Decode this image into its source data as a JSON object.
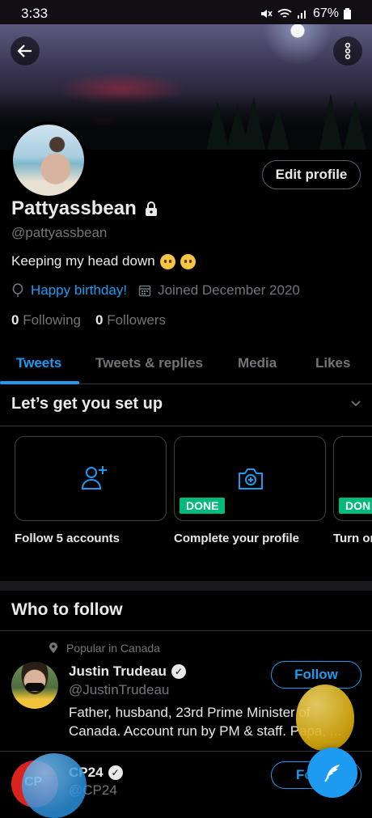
{
  "status_bar": {
    "time": "3:33",
    "battery": "67%",
    "icons": [
      "mute-icon",
      "wifi-icon",
      "signal-icon",
      "battery-icon"
    ]
  },
  "profile": {
    "display_name": "Pattyassbean",
    "handle": "@pattyassbean",
    "bio": "Keeping my head down",
    "birthday": "Happy birthday!",
    "joined": "Joined December 2020",
    "following_count": "0",
    "following_label": "Following",
    "followers_count": "0",
    "followers_label": "Followers",
    "edit_label": "Edit profile"
  },
  "tabs": [
    {
      "label": "Tweets",
      "active": true
    },
    {
      "label": "Tweets & replies",
      "active": false
    },
    {
      "label": "Media",
      "active": false
    },
    {
      "label": "Likes",
      "active": false
    }
  ],
  "setup": {
    "title": "Let’s get you set up",
    "cards": [
      {
        "label": "Follow 5 accounts",
        "icon": "add-user-icon",
        "badge": ""
      },
      {
        "label": "Complete your profile",
        "icon": "camera-add-icon",
        "badge": "DONE"
      },
      {
        "label": "Turn or",
        "icon": "",
        "badge": "DON"
      }
    ]
  },
  "who_to_follow": {
    "title": "Who to follow",
    "context": "Popular in Canada",
    "users": [
      {
        "name": "Justin Trudeau",
        "handle": "@JustinTrudeau",
        "bio": "Father, husband, 23rd Prime Minister of Canada. Account run by PM & staff. Papa, ...",
        "button": "Follow"
      },
      {
        "name": "CP24",
        "handle": "@CP24",
        "button": "Fo"
      }
    ]
  },
  "colors": {
    "accent": "#1d9bf0",
    "done": "#00ba7c",
    "muted": "#71767b"
  }
}
